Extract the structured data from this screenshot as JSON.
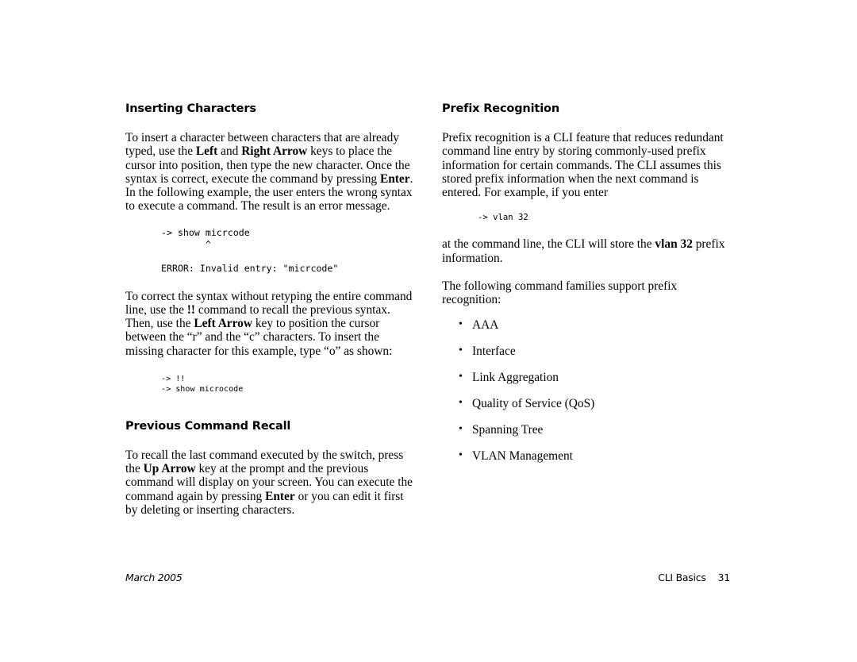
{
  "document": {
    "left_column": {
      "heading_1": "Inserting Characters",
      "paragraph_1": {
        "part_1": "To insert a character between characters that are already typed, use the ",
        "bold_1": "Left",
        "part_2": " and ",
        "bold_2": "Right Arrow",
        "part_3": " keys to place the cursor into position, then type the new character. Once the syntax is correct, execute the command by pressing ",
        "bold_3": "Enter",
        "part_4": ". In the following example, the user enters the wrong syntax to execute a command. The result is an error message."
      },
      "code_block_1": "-> show micrcode\n        ^\n\nERROR: Invalid entry: \"micrcode\"",
      "paragraph_2": {
        "part_1": "To correct the syntax without retyping the entire command line, use the ",
        "bold_1": "!!",
        "part_2": " command to recall the previous syntax. Then, use the ",
        "bold_2": "Left Arrow",
        "part_3": " key to position the cursor between the “r” and the “c” characters. To insert the missing character for this example, type “o” as shown:"
      },
      "code_block_2": "-> !!\n-> show microcode",
      "heading_2": "Previous Command Recall",
      "paragraph_3": {
        "part_1": "To recall the last command executed by the switch, press the ",
        "bold_1": "Up Arrow",
        "part_2": " key at the prompt and the previous command will display on your screen. You can execute the command again by pressing ",
        "bold_2": "Enter",
        "part_3": " or you can edit it first by deleting or inserting characters."
      }
    },
    "right_column": {
      "heading_1": "Prefix Recognition",
      "paragraph_1": "Prefix recognition is a CLI feature that reduces redundant command line entry by storing commonly-used prefix information for certain commands. The CLI assumes this stored prefix information when the next command is entered. For example, if you enter",
      "code_block_1": "-> vlan 32",
      "paragraph_2": {
        "part_1": "at the command line, the CLI will store the ",
        "bold_1": "vlan 32",
        "part_2": " prefix information."
      },
      "paragraph_3": "The following command families support prefix recognition:",
      "bullet_glyph": "•",
      "family_list": [
        "AAA",
        "Interface",
        "Link Aggregation",
        "Quality of Service (QoS)",
        "Spanning Tree",
        "VLAN Management"
      ]
    },
    "footer": {
      "date": "March 2005",
      "chapter_and_page": "CLI Basics    31"
    }
  }
}
